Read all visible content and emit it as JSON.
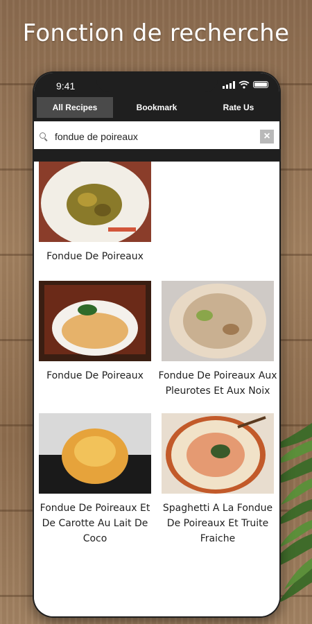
{
  "headline": "Fonction de recherche",
  "status_bar": {
    "time": "9:41"
  },
  "tabs": [
    {
      "label": "All Recipes",
      "active": true
    },
    {
      "label": "Bookmark",
      "active": false
    },
    {
      "label": "Rate Us",
      "active": false
    }
  ],
  "search": {
    "value": "fondue de poireaux",
    "clear_label": "×"
  },
  "results": [
    {
      "title": "Fondue De Poireaux"
    },
    {
      "title": "Fondue De Poireaux"
    },
    {
      "title": "Fondue De Poireaux Aux Pleurotes Et Aux Noix"
    },
    {
      "title": "Fondue De Poireaux Et De Carotte Au Lait De Coco"
    },
    {
      "title": "Spaghetti A La Fondue De Poireaux Et Truite Fraiche"
    }
  ],
  "colors": {
    "frame": "#1f1f1f",
    "active_tab": "#4a4a4a",
    "wood": "#9a7a5a"
  }
}
